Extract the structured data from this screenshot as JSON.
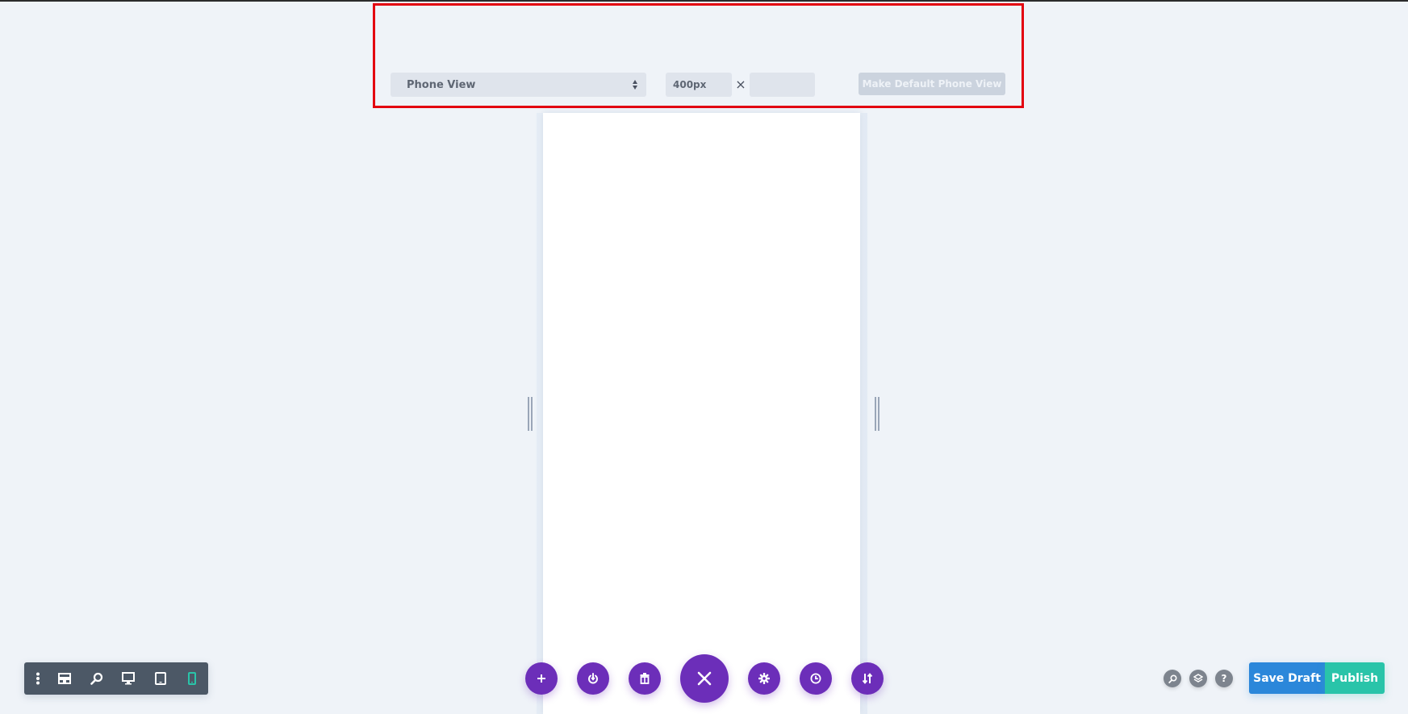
{
  "responsive_toolbar": {
    "view_select": {
      "selected": "Phone View"
    },
    "width_input": {
      "value": "400px"
    },
    "separator": "×",
    "height_input": {
      "value": ""
    },
    "make_default_button": "Make Default Phone View",
    "highlight_color": "#e3000f"
  },
  "view_mode_bar": {
    "items": [
      {
        "name": "menu",
        "icon": "vertical-dots-icon"
      },
      {
        "name": "wireframe",
        "icon": "layout-icon"
      },
      {
        "name": "zoom",
        "icon": "zoom-icon"
      },
      {
        "name": "desktop",
        "icon": "desktop-icon"
      },
      {
        "name": "tablet",
        "icon": "tablet-icon"
      },
      {
        "name": "phone",
        "icon": "phone-icon",
        "active": true
      }
    ],
    "active_color": "#29c4a9"
  },
  "action_buttons": [
    {
      "name": "add",
      "icon": "plus-icon"
    },
    {
      "name": "portability",
      "icon": "power-icon"
    },
    {
      "name": "clear",
      "icon": "trash-icon"
    },
    {
      "name": "close",
      "icon": "close-icon"
    },
    {
      "name": "settings",
      "icon": "gear-icon"
    },
    {
      "name": "history",
      "icon": "clock-icon"
    },
    {
      "name": "sort",
      "icon": "sort-arrows-icon"
    }
  ],
  "action_color": "#6c2eb9",
  "right_controls": {
    "icons": [
      {
        "name": "search",
        "icon": "search-icon"
      },
      {
        "name": "layers",
        "icon": "layers-icon"
      },
      {
        "name": "help",
        "icon": "help-icon",
        "glyph": "?"
      }
    ],
    "save_draft": "Save Draft",
    "publish": "Publish",
    "save_color": "#2b87da",
    "publish_color": "#29c4a9"
  }
}
